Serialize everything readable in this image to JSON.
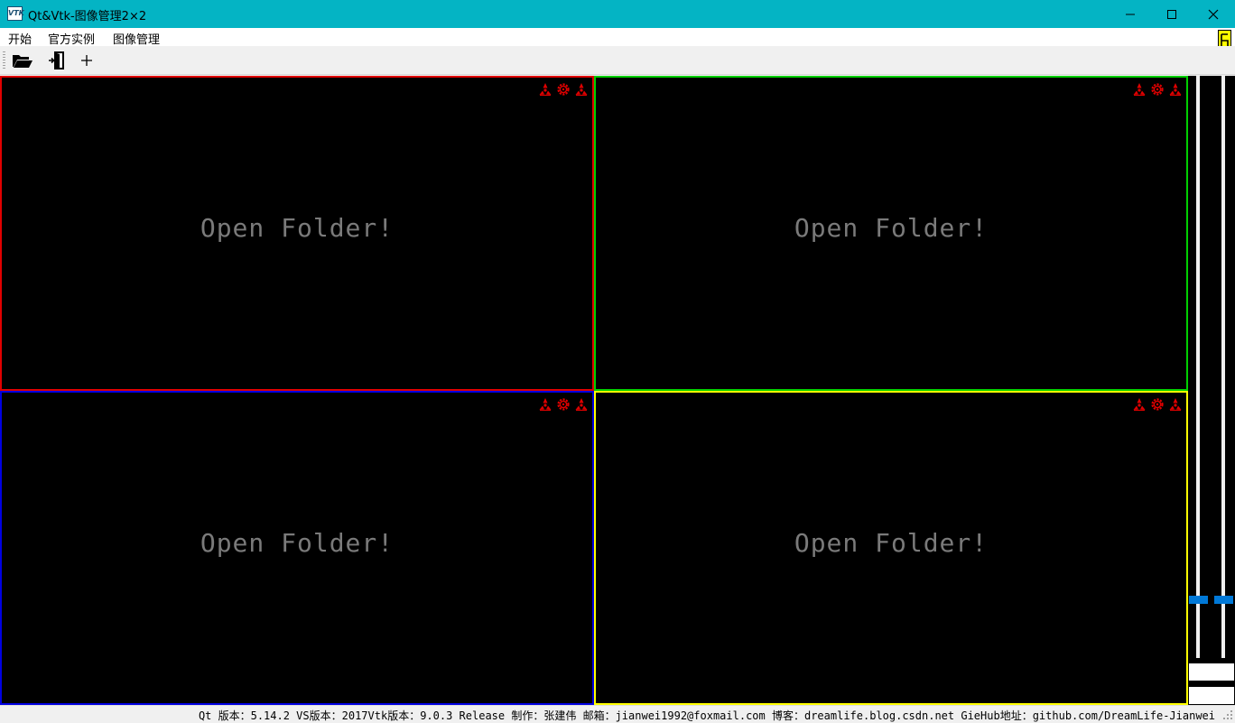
{
  "window": {
    "icon_text": "VTK",
    "title": "Qt&Vtk-图像管理2×2",
    "minimize_icon": "minimize-icon",
    "maximize_icon": "maximize-icon",
    "close_icon": "close-icon",
    "titlebar_color": "#04b4c4"
  },
  "menu": {
    "items": [
      "开始",
      "官方实例",
      "图像管理"
    ]
  },
  "toolbar": {
    "buttons": [
      {
        "icon": "folder-open-icon"
      },
      {
        "icon": "exit-door-icon"
      },
      {
        "icon": "plus-icon"
      }
    ]
  },
  "views": [
    {
      "message": "Open Folder!",
      "border_color": "#e00000",
      "icons": [
        "radiation-icon",
        "gear-icon",
        "radiation-icon"
      ]
    },
    {
      "message": "Open Folder!",
      "border_color": "#00d000",
      "icons": [
        "radiation-icon",
        "gear-icon",
        "radiation-icon"
      ]
    },
    {
      "message": "Open Folder!",
      "border_color": "#0000e0",
      "icons": [
        "radiation-icon",
        "gear-icon",
        "radiation-icon"
      ]
    },
    {
      "message": "Open Folder!",
      "border_color": "#ffff00",
      "icons": [
        "radiation-icon",
        "gear-icon",
        "radiation-icon"
      ]
    }
  ],
  "side_panel": {
    "slider_accent": "#0078d7"
  },
  "status": {
    "text": "Qt 版本：5.14.2  VS版本：2017Vtk版本：9.0.3 Release 制作：张建伟 邮箱：jianwei1992@foxmail.com 博客：dreamlife.blog.csdn.net GieHub地址：github.com/DreamLife-Jianwei"
  }
}
